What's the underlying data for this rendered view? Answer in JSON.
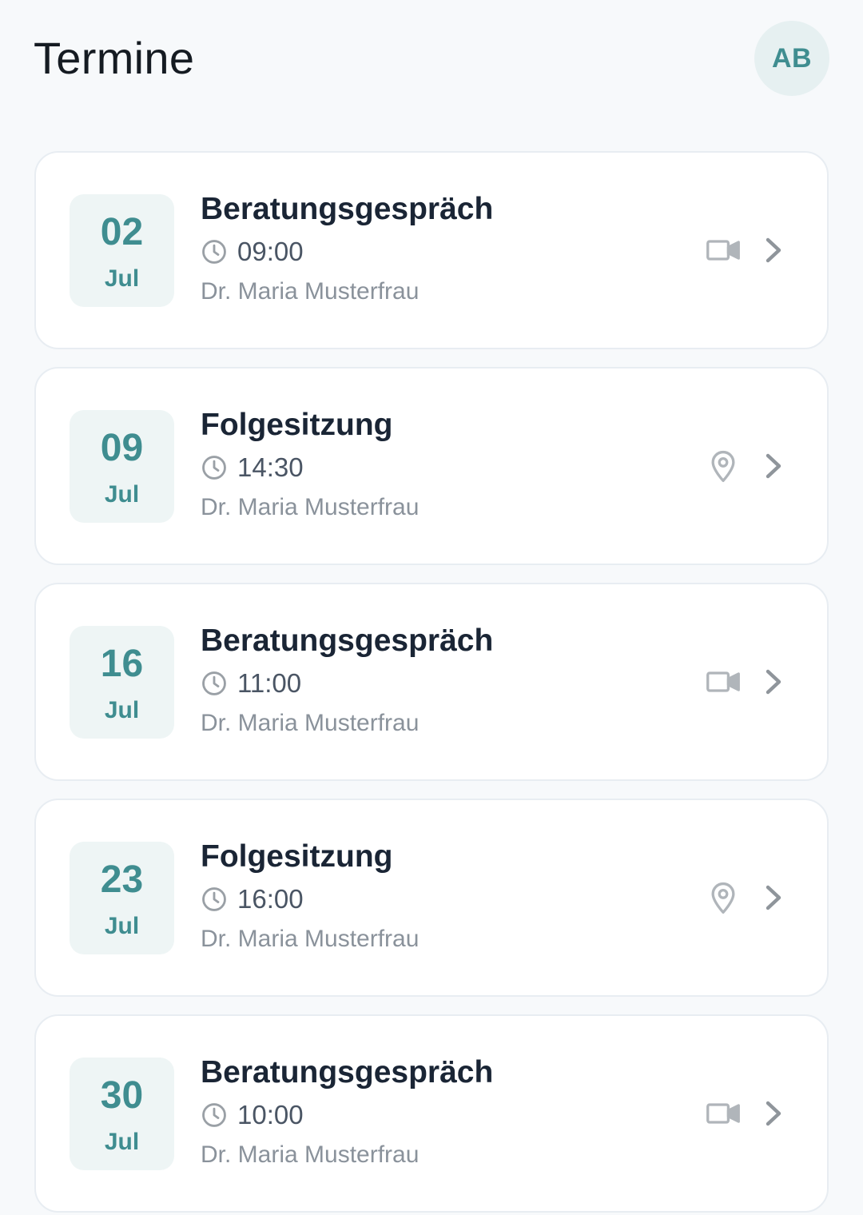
{
  "header": {
    "title": "Termine",
    "avatar_initials": "AB"
  },
  "colors": {
    "accent": "#3f8d90",
    "date_bg": "#eef5f5",
    "text_dark": "#1a2535",
    "text_muted": "#8a929b",
    "icon_gray": "#b0b5ba"
  },
  "appointments": [
    {
      "day": "02",
      "month": "Jul",
      "title": "Beratungsgespräch",
      "time": "09:00",
      "doctor": "Dr. Maria Musterfrau",
      "type_icon": "video-camera-icon"
    },
    {
      "day": "09",
      "month": "Jul",
      "title": "Folgesitzung",
      "time": "14:30",
      "doctor": "Dr. Maria Musterfrau",
      "type_icon": "location-pin-icon"
    },
    {
      "day": "16",
      "month": "Jul",
      "title": "Beratungsgespräch",
      "time": "11:00",
      "doctor": "Dr. Maria Musterfrau",
      "type_icon": "video-camera-icon"
    },
    {
      "day": "23",
      "month": "Jul",
      "title": "Folgesitzung",
      "time": "16:00",
      "doctor": "Dr. Maria Musterfrau",
      "type_icon": "location-pin-icon"
    },
    {
      "day": "30",
      "month": "Jul",
      "title": "Beratungsgespräch",
      "time": "10:00",
      "doctor": "Dr. Maria Musterfrau",
      "type_icon": "video-camera-icon"
    }
  ]
}
